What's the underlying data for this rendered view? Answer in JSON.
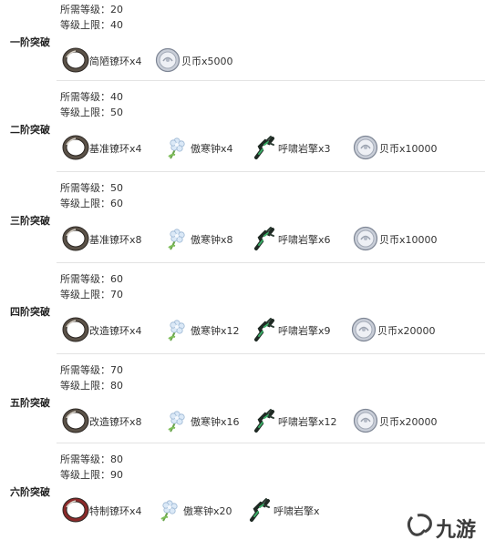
{
  "labels": {
    "required_level": "所需等级：",
    "level_cap": "等级上限："
  },
  "tiers": [
    {
      "name": "一阶突破",
      "required_level": "20",
      "level_cap": "40",
      "materials": [
        {
          "icon": "ring-icon",
          "text": "简陋镣环x4"
        },
        {
          "icon": "coin-icon",
          "text": "贝币x5000"
        }
      ]
    },
    {
      "name": "二阶突破",
      "required_level": "40",
      "level_cap": "50",
      "materials": [
        {
          "icon": "ring-icon",
          "text": "基准镣环x4"
        },
        {
          "icon": "flower-icon",
          "text": "傲寒钟x4"
        },
        {
          "icon": "claw-icon",
          "text": "呼啸岩擎x3"
        },
        {
          "icon": "coin-icon",
          "text": "贝币x10000"
        }
      ]
    },
    {
      "name": "三阶突破",
      "required_level": "50",
      "level_cap": "60",
      "materials": [
        {
          "icon": "ring-icon",
          "text": "基准镣环x8"
        },
        {
          "icon": "flower-icon",
          "text": "傲寒钟x8"
        },
        {
          "icon": "claw-icon",
          "text": "呼啸岩擎x6"
        },
        {
          "icon": "coin-icon",
          "text": "贝币x10000"
        }
      ]
    },
    {
      "name": "四阶突破",
      "required_level": "60",
      "level_cap": "70",
      "materials": [
        {
          "icon": "ring-icon",
          "text": "改造镣环x4"
        },
        {
          "icon": "flower-icon",
          "text": "傲寒钟x12"
        },
        {
          "icon": "claw-icon",
          "text": "呼啸岩擎x9"
        },
        {
          "icon": "coin-icon",
          "text": "贝币x20000"
        }
      ]
    },
    {
      "name": "五阶突破",
      "required_level": "70",
      "level_cap": "80",
      "materials": [
        {
          "icon": "ring-icon",
          "text": "改造镣环x8"
        },
        {
          "icon": "flower-icon",
          "text": "傲寒钟x16"
        },
        {
          "icon": "claw-icon",
          "text": "呼啸岩擎x12"
        },
        {
          "icon": "coin-icon",
          "text": "贝币x20000"
        }
      ]
    },
    {
      "name": "六阶突破",
      "required_level": "80",
      "level_cap": "90",
      "materials": [
        {
          "icon": "ring-red-icon",
          "text": "特制镣环x4"
        },
        {
          "icon": "flower-icon",
          "text": "傲寒钟x20"
        },
        {
          "icon": "claw-icon",
          "text": "呼啸岩擎x"
        }
      ]
    }
  ],
  "watermark": {
    "text": "九游",
    "color": "#1a1a1a"
  }
}
